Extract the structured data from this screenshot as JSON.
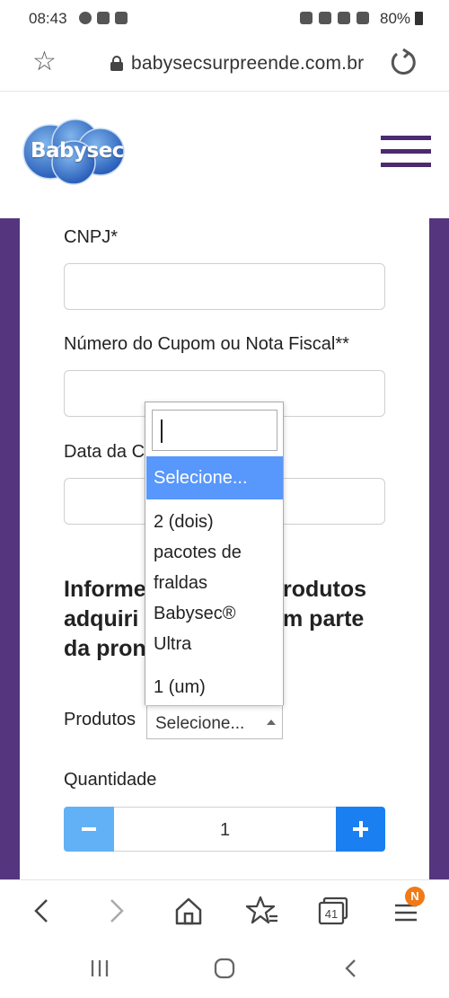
{
  "status_bar": {
    "time": "08:43",
    "battery": "80%"
  },
  "browser": {
    "url": "babysecsurpreende.com.br",
    "tabs_count": "41",
    "menu_badge": "N"
  },
  "site": {
    "logo_text": "Babysec",
    "colors": {
      "purple": "#55367e",
      "accent_blue": "#1a7ff0",
      "selected_option": "#5897fb"
    }
  },
  "form": {
    "cnpj_label": "CNPJ*",
    "cupom_label": "Número do Cupom ou Nota Fiscal**",
    "data_label_visible": "Data da C",
    "section_heading_lines": [
      "Informe",
      "adquiri",
      "da pron"
    ],
    "section_heading_tail_lines": [
      "rodutos",
      "m parte"
    ],
    "produtos_label": "Produtos",
    "produtos_select_value": "Selecione...",
    "quantidade_label": "Quantidade",
    "quantity_value": "1"
  },
  "dropdown": {
    "search_value": "",
    "options": [
      {
        "label": "Selecione...",
        "selected": true
      },
      {
        "label": "2 (dois) pacotes de fraldas Babysec® Ultra",
        "lines": [
          "2 (dois)",
          "pacotes de",
          "fraldas",
          "Babysec®",
          "Ultra"
        ],
        "selected": false
      },
      {
        "label": "1 (um)",
        "selected": false
      }
    ]
  }
}
